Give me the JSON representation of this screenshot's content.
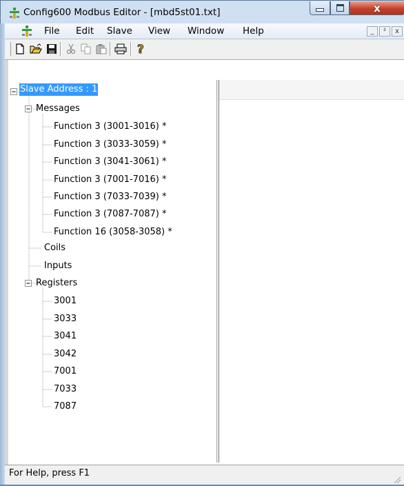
{
  "window": {
    "title": "Config600 Modbus Editor - [mbd5st01.txt]",
    "close_glyph": "x"
  },
  "menubar": {
    "items": [
      "File",
      "Edit",
      "Slave",
      "View",
      "Window",
      "Help"
    ],
    "mdi_minimize": "_",
    "mdi_restore": "²",
    "mdi_close": "x"
  },
  "toolbar": {
    "buttons": [
      "new-icon",
      "open-icon",
      "save-icon",
      "cut-icon",
      "copy-icon",
      "paste-icon",
      "print-icon",
      "help-icon"
    ]
  },
  "tree": {
    "root": "Slave Address : 1",
    "messages_label": "Messages",
    "messages": [
      "Function 3 (3001-3016) *",
      "Function 3 (3033-3059) *",
      "Function 3 (3041-3061) *",
      "Function 3 (7001-7016) *",
      "Function 3 (7033-7039) *",
      "Function 3 (7087-7087) *",
      "Function 16 (3058-3058) *"
    ],
    "coils_label": "Coils",
    "inputs_label": "Inputs",
    "registers_label": "Registers",
    "registers": [
      "3001",
      "3033",
      "3041",
      "3042",
      "7001",
      "7033",
      "7087"
    ],
    "expand_glyph": "−"
  },
  "status": {
    "text": "For Help, press F1"
  },
  "colors": {
    "selection": "#3399ff",
    "close_button": "#c4412c",
    "titlebar": "#cfe0f2"
  }
}
